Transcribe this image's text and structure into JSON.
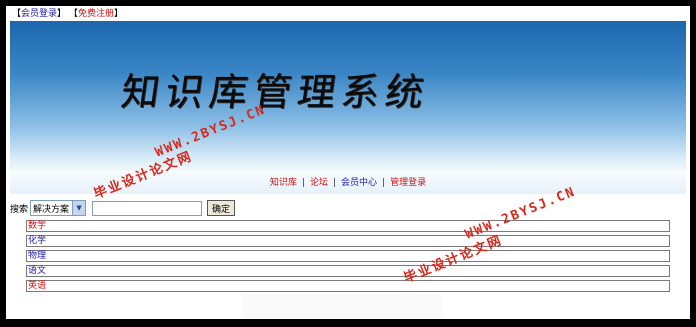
{
  "top_links": {
    "login": "会员登录",
    "register": "免费注册"
  },
  "banner": {
    "title": "知识库管理系统"
  },
  "watermarks": [
    {
      "text": "毕业设计论文网",
      "url": "WWW.2BYSJ.CN"
    },
    {
      "text": "毕业设计论文网",
      "url": "WWW.2BYSJ.CN"
    }
  ],
  "nav": {
    "items": [
      {
        "label": "知识库",
        "color": "#d01010"
      },
      {
        "label": "论坛",
        "color": "#d01010"
      },
      {
        "label": "会员中心",
        "color": "#1a1aaa"
      },
      {
        "label": "管理登录",
        "color": "#d01010"
      }
    ],
    "separator": "|"
  },
  "search": {
    "label": "搜索",
    "selected_option": "解决方案",
    "input_value": "",
    "button_label": "确定"
  },
  "categories": [
    {
      "label": "数学",
      "color": "#d01010"
    },
    {
      "label": "化学",
      "color": "#1a1aaa"
    },
    {
      "label": "物理",
      "color": "#1a1aaa"
    },
    {
      "label": "语文",
      "color": "#1a1aaa"
    },
    {
      "label": "英语",
      "color": "#d01010"
    }
  ],
  "colors": {
    "banner_top": "#1c67ad",
    "banner_bottom": "#f2f8fc",
    "watermark": "#d8261a"
  }
}
